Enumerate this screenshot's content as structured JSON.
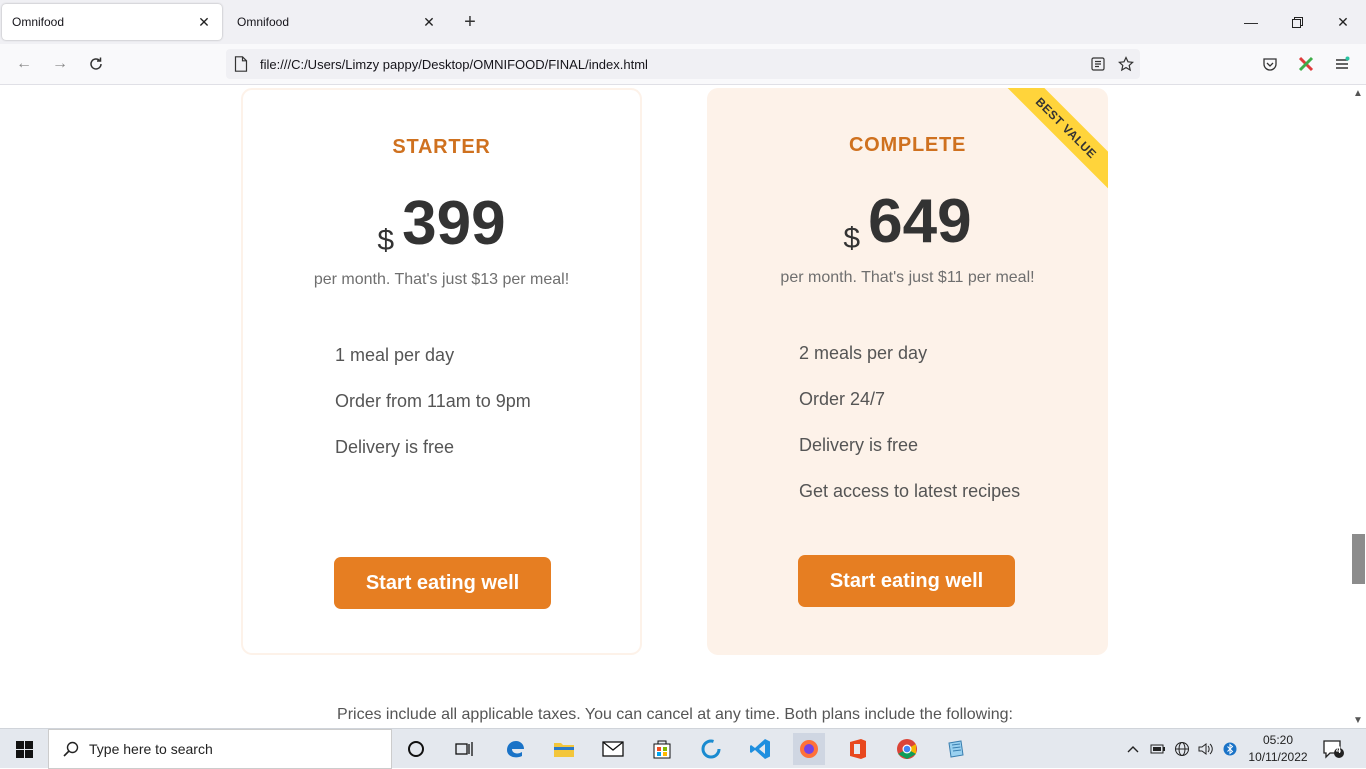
{
  "browser": {
    "tabs": [
      {
        "title": "Omnifood",
        "active": true
      },
      {
        "title": "Omnifood",
        "active": false
      }
    ],
    "url": "file:///C:/Users/Limzy pappy/Desktop/OMNIFOOD/FINAL/index.html"
  },
  "pricing": {
    "plans": [
      {
        "name": "STARTER",
        "currency": "$",
        "price": "399",
        "price_text": "per month. That's just $13 per meal!",
        "features": [
          "1 meal per day",
          "Order from 11am to 9pm",
          "Delivery is free"
        ],
        "cta": "Start eating well"
      },
      {
        "name": "COMPLETE",
        "currency": "$",
        "price": "649",
        "price_text": "per month. That's just $11 per meal!",
        "features": [
          "2 meals per day",
          "Order 24/7",
          "Delivery is free",
          "Get access to latest recipes"
        ],
        "cta": "Start eating well",
        "badge": "BEST VALUE"
      }
    ],
    "details": "Prices include all applicable taxes. You can cancel at any time. Both plans include the following:"
  },
  "taskbar": {
    "search_placeholder": "Type here to search",
    "time": "05:20",
    "date": "10/11/2022",
    "notification_count": "4"
  },
  "colors": {
    "accent": "#e67e22",
    "plan_title": "#cf711f",
    "card_tint": "#fdf2e9",
    "ribbon": "#ffd43b"
  }
}
